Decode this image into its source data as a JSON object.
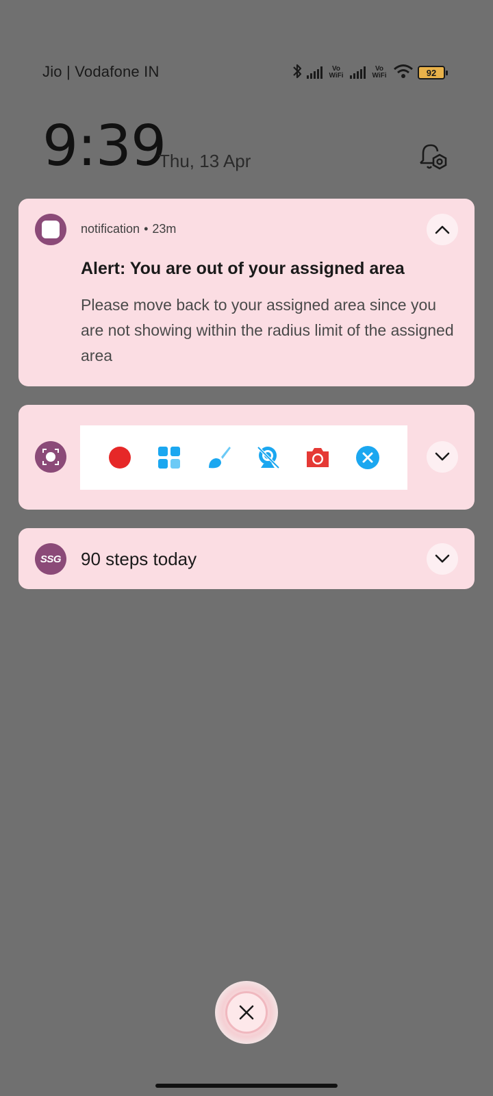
{
  "status_bar": {
    "carrier": "Jio | Vodafone IN",
    "vowifi_1": "Vo WiFi",
    "vowifi_2": "Vo WiFi",
    "battery": "92"
  },
  "lockscreen": {
    "time": "9:39",
    "date": "Thu, 13 Apr"
  },
  "notifications": [
    {
      "app": "notification",
      "age": "23m",
      "title": "Alert: You are out of your assigned area",
      "body": "Please move back to your assigned area since you are not showing within the radius limit of the assigned area",
      "expanded": true
    },
    {
      "app": "screen-recorder",
      "tools": [
        "record-icon",
        "grid-icon",
        "brush-icon",
        "webcam-icon",
        "camera-icon",
        "close-icon"
      ],
      "colors": {
        "record": "#e62828",
        "blue": "#1ba7f0",
        "camera": "#e53935"
      }
    },
    {
      "app_badge": "SSG",
      "title": "90 steps today"
    }
  ],
  "colors": {
    "background": "#707070",
    "card": "#fbdde3",
    "app_icon": "#8b4a78"
  }
}
